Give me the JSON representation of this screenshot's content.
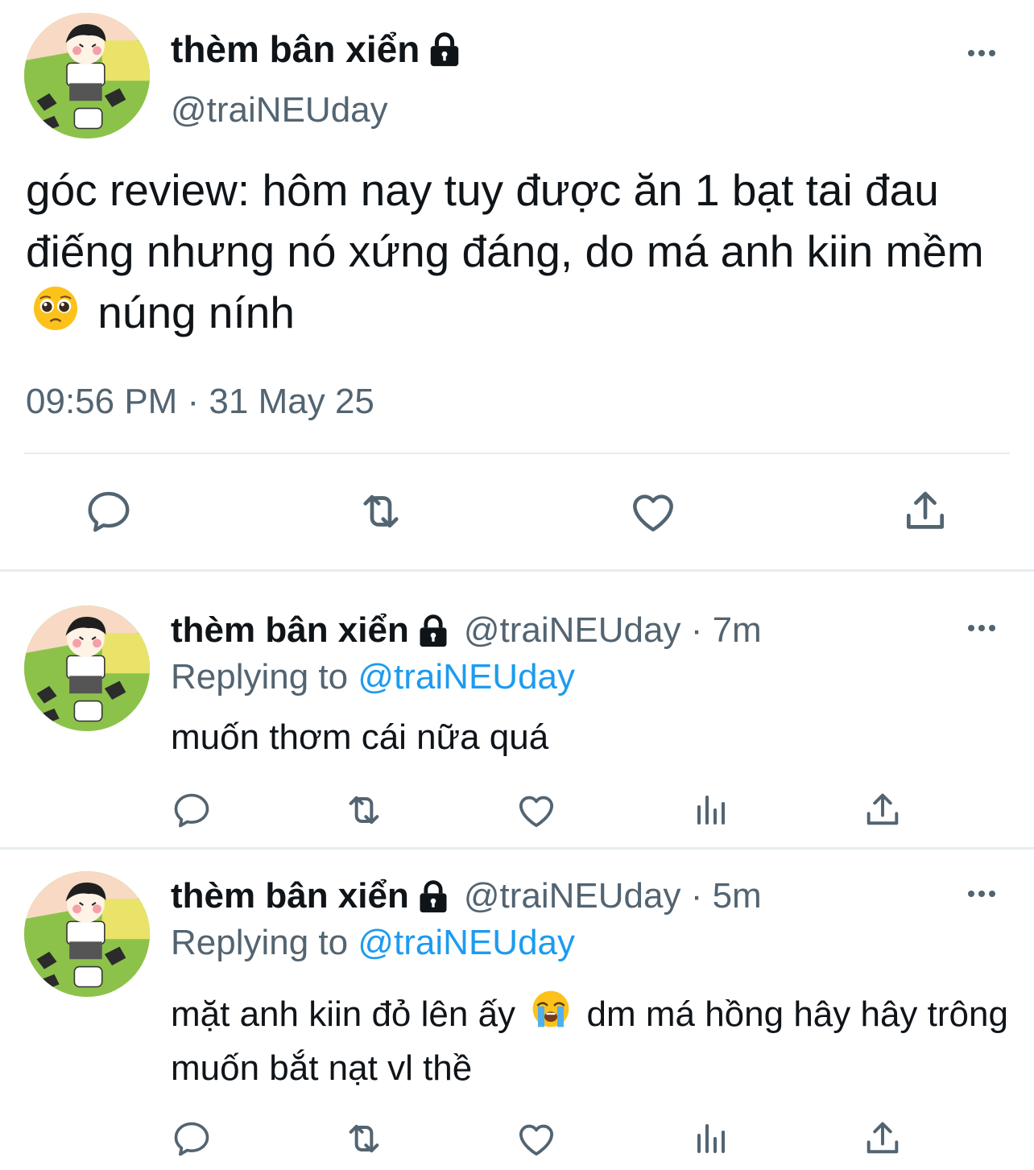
{
  "main_tweet": {
    "display_name": "thèm bân xiển",
    "handle": "@traiNEUday",
    "text_part1": "góc review: hôm nay tuy được ăn 1 bạt tai đau điếng nhưng nó xứng đáng, do má anh kiin mềm",
    "text_part2": "núng nính",
    "emoji": "pleading-face",
    "timestamp": "09:56 PM · 31 May 25"
  },
  "replies": [
    {
      "display_name": "thèm bân xiển",
      "handle_time": "@traiNEUday · 7m",
      "replying_label": "Replying to",
      "replying_handle": "@traiNEUday",
      "text_part1": "muốn thơm cái nữa quá",
      "text_part2": "",
      "emoji": ""
    },
    {
      "display_name": "thèm bân xiển",
      "handle_time": "@traiNEUday · 5m",
      "replying_label": "Replying to",
      "replying_handle": "@traiNEUday",
      "text_part1": "mặt anh kiin đỏ lên ấy",
      "text_part2": "dm má hồng hây hây trông muốn bắt nạt vl thề",
      "emoji": "loudly-crying-face"
    }
  ],
  "colors": {
    "text": "#0f1419",
    "secondary": "#536471",
    "link": "#1d9bf0",
    "divider": "#e6ecf0"
  },
  "icons": [
    "lock-icon",
    "more-icon",
    "reply-icon",
    "retweet-icon",
    "like-icon",
    "share-icon",
    "analytics-icon"
  ]
}
